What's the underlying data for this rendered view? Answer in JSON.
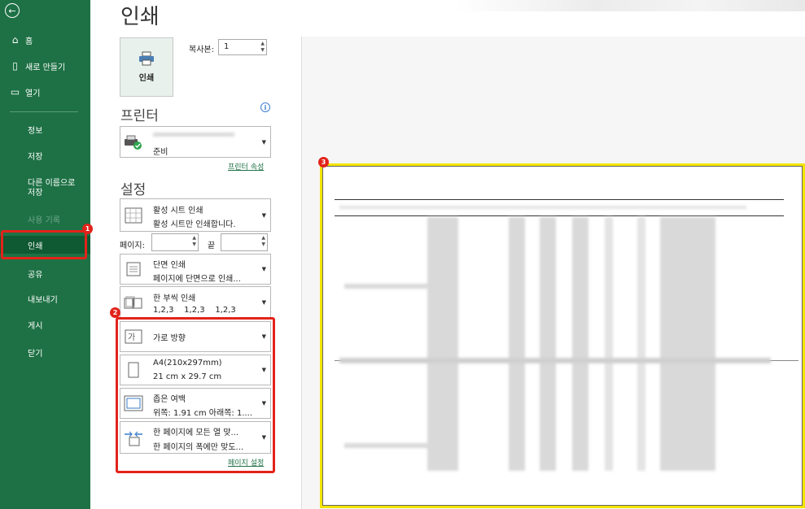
{
  "sidebar": {
    "back": "←",
    "items": [
      {
        "label": "홈",
        "icon": "⌂"
      },
      {
        "label": "새로 만들기",
        "icon": "▯"
      },
      {
        "label": "열기",
        "icon": "▭"
      }
    ],
    "sub_items": [
      {
        "label": "정보"
      },
      {
        "label": "저장"
      },
      {
        "label": "다른 이름으로\n저장"
      },
      {
        "label": "사용 기록"
      },
      {
        "label": "인쇄"
      },
      {
        "label": "공유"
      },
      {
        "label": "내보내기"
      },
      {
        "label": "게시"
      },
      {
        "label": "닫기"
      }
    ]
  },
  "main": {
    "title": "인쇄",
    "print_button": "인쇄",
    "copies_label": "복사본:",
    "copies_value": "1",
    "printer_heading": "프린터",
    "printer_status": "준비",
    "printer_props_link": "프린터 속성",
    "settings_heading": "설정",
    "settings": [
      {
        "line1": "활성 시트 인쇄",
        "line2": "활성 시트만 인쇄합니다."
      },
      {
        "line1": "단면 인쇄",
        "line2": "페이지에 단면으로 인쇄..."
      },
      {
        "line1": "한 부씩 인쇄",
        "line2": "1,2,3    1,2,3    1,2,3"
      },
      {
        "line1": "가로 방향",
        "line2": ""
      },
      {
        "line1": "A4(210x297mm)",
        "line2": "21 cm x 29.7 cm"
      },
      {
        "line1": "좁은 여백",
        "line2": "위쪽: 1.91 cm 아래쪽: 1...."
      },
      {
        "line1": "한 페이지에 모든 열 맞...",
        "line2": "한 페이지의 폭에만 맞도..."
      }
    ],
    "pages_label": "페이지:",
    "to_label": "끝",
    "page_setup_link": "페이지 설정"
  },
  "annotations": [
    "1",
    "2",
    "3"
  ],
  "colors": {
    "sidebar": "#1e7145",
    "highlight": "#e2231a",
    "preview_border": "#f2e500"
  }
}
